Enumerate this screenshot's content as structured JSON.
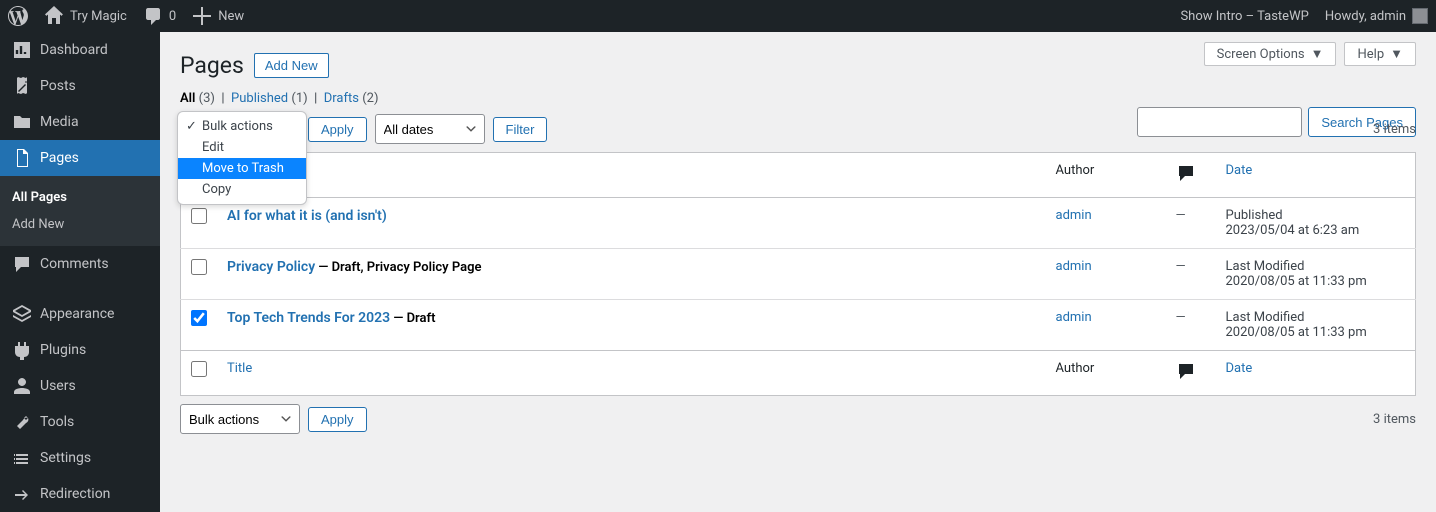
{
  "adminBar": {
    "tryMagic": "Try Magic",
    "commentCount": "0",
    "new": "New",
    "showIntro": "Show Intro – TasteWP",
    "howdy": "Howdy, admin"
  },
  "sidebar": {
    "dashboard": "Dashboard",
    "posts": "Posts",
    "media": "Media",
    "pages": "Pages",
    "allPages": "All Pages",
    "addNew": "Add New",
    "comments": "Comments",
    "appearance": "Appearance",
    "plugins": "Plugins",
    "users": "Users",
    "tools": "Tools",
    "settings": "Settings",
    "redirection": "Redirection"
  },
  "header": {
    "title": "Pages",
    "addNew": "Add New",
    "screenOptions": "Screen Options",
    "help": "Help"
  },
  "filters": {
    "all": "All",
    "allCount": "(3)",
    "published": "Published",
    "publishedCount": "(1)",
    "drafts": "Drafts",
    "draftsCount": "(2)"
  },
  "search": {
    "button": "Search Pages"
  },
  "bulk": {
    "label": "Bulk actions",
    "apply": "Apply",
    "allDates": "All dates",
    "filter": "Filter",
    "itemCount": "3 items"
  },
  "dropdown": {
    "bulkActions": "Bulk actions",
    "edit": "Edit",
    "moveToTrash": "Move to Trash",
    "copy": "Copy"
  },
  "table": {
    "title": "Title",
    "author": "Author",
    "date": "Date",
    "rows": [
      {
        "title": "AI for what it is (and isn't)",
        "state": "",
        "author": "admin",
        "comments": "—",
        "dateLabel": "Published",
        "dateValue": "2023/05/04 at 6:23 am",
        "checked": false
      },
      {
        "title": "Privacy Policy",
        "state": " — Draft, Privacy Policy Page",
        "author": "admin",
        "comments": "—",
        "dateLabel": "Last Modified",
        "dateValue": "2020/08/05 at 11:33 pm",
        "checked": false
      },
      {
        "title": "Top Tech Trends For 2023",
        "state": " — Draft",
        "author": "admin",
        "comments": "—",
        "dateLabel": "Last Modified",
        "dateValue": "2020/08/05 at 11:33 pm",
        "checked": true
      }
    ]
  }
}
